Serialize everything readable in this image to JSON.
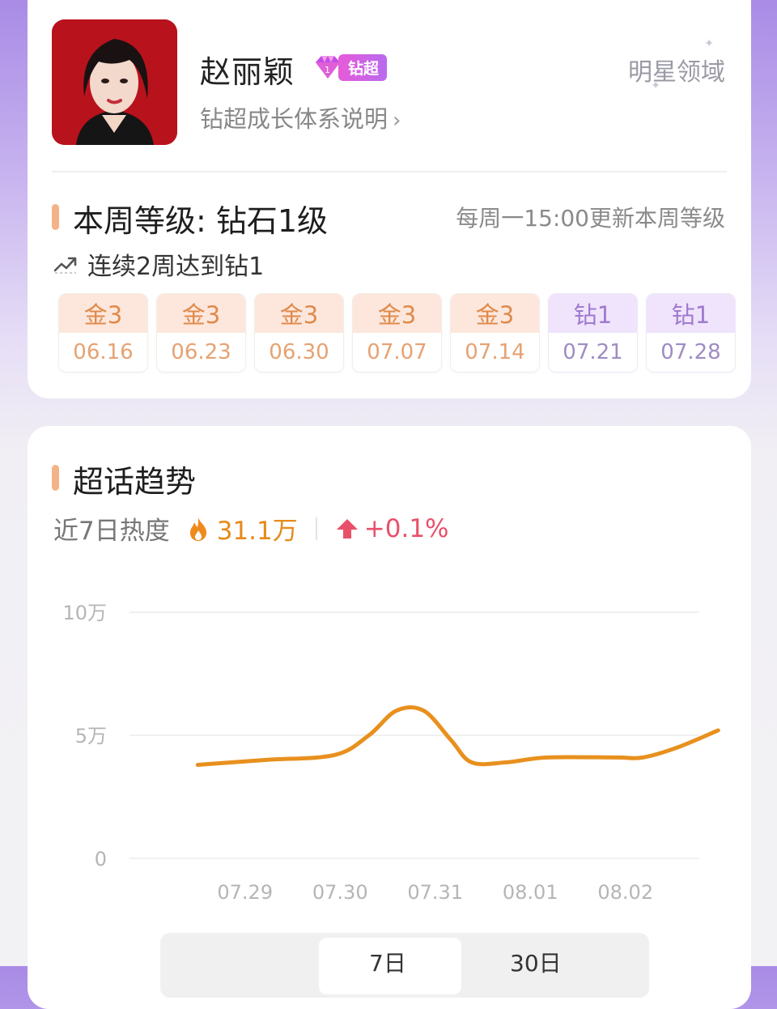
{
  "profile": {
    "name": "赵丽颖",
    "badge_label": "钻超",
    "growth_link": "钻超成长体系说明",
    "domain_label": "明星领域"
  },
  "level": {
    "title": "本周等级: 钻石1级",
    "update_note": "每周一15:00更新本周等级",
    "streak": "连续2周达到钻1",
    "weeks": [
      {
        "level": "金3",
        "date": "06.16",
        "tier": "gold"
      },
      {
        "level": "金3",
        "date": "06.23",
        "tier": "gold"
      },
      {
        "level": "金3",
        "date": "06.30",
        "tier": "gold"
      },
      {
        "level": "金3",
        "date": "07.07",
        "tier": "gold"
      },
      {
        "level": "金3",
        "date": "07.14",
        "tier": "gold"
      },
      {
        "level": "钻1",
        "date": "07.21",
        "tier": "diamond"
      },
      {
        "level": "钻1",
        "date": "07.28",
        "tier": "diamond"
      }
    ]
  },
  "trend": {
    "title": "超话趋势",
    "heat_label": "近7日热度",
    "heat_value": "31.1万",
    "change": "+0.1%",
    "range_options": [
      "",
      "7日",
      "30日"
    ],
    "selected_range": "7日"
  },
  "chart_data": {
    "type": "line",
    "x": [
      "07.29",
      "07.30",
      "07.31",
      "08.01",
      "08.02"
    ],
    "y_ticks": [
      "10万",
      "5万",
      "0"
    ],
    "ylim": [
      0,
      100000
    ],
    "series": [
      {
        "color": "#e8901e",
        "points": [
          {
            "x": 0.5,
            "y": 38000
          },
          {
            "x": 1.5,
            "y": 40000
          },
          {
            "x": 2.5,
            "y": 42000
          },
          {
            "x": 3.0,
            "y": 50000
          },
          {
            "x": 3.4,
            "y": 60000
          },
          {
            "x": 3.8,
            "y": 60000
          },
          {
            "x": 4.2,
            "y": 48000
          },
          {
            "x": 4.5,
            "y": 39000
          },
          {
            "x": 5.0,
            "y": 39000
          },
          {
            "x": 5.6,
            "y": 41000
          },
          {
            "x": 6.6,
            "y": 41000
          },
          {
            "x": 7.0,
            "y": 41000
          },
          {
            "x": 7.5,
            "y": 45000
          },
          {
            "x": 8.1,
            "y": 52000
          }
        ]
      }
    ]
  }
}
